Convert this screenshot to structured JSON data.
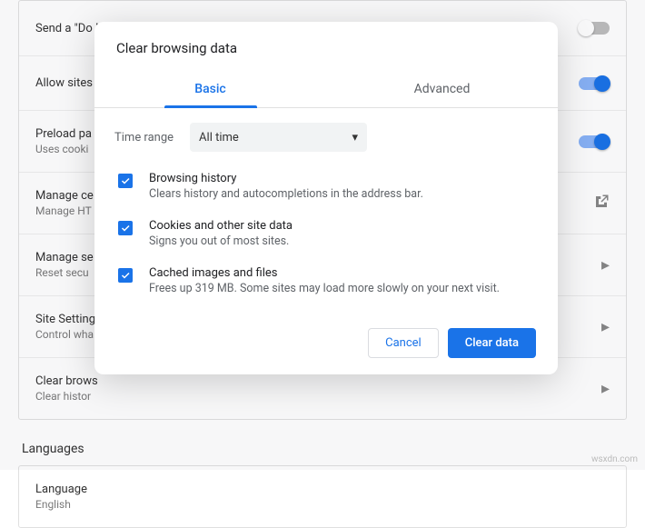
{
  "bg": {
    "rows": [
      {
        "title": "Send a \"Do Not Track\" request with your browsing traffic",
        "sub": "",
        "right": "toggle-off"
      },
      {
        "title": "Allow sites",
        "sub": "",
        "right": "toggle-on"
      },
      {
        "title": "Preload pa",
        "sub": "Uses cooki",
        "right": "toggle-on"
      },
      {
        "title": "Manage ce",
        "sub": "Manage HT",
        "right": "external"
      },
      {
        "title": "Manage se",
        "sub": "Reset secu",
        "right": "chevron"
      },
      {
        "title": "Site Setting",
        "sub": "Control wha",
        "right": "chevron"
      },
      {
        "title": "Clear brows",
        "sub": "Clear histor",
        "right": "chevron"
      }
    ],
    "section_heading": "Languages",
    "lang_row": {
      "title": "Language",
      "sub": "English"
    }
  },
  "dialog": {
    "title": "Clear browsing data",
    "tabs": {
      "basic": "Basic",
      "advanced": "Advanced"
    },
    "range_label": "Time range",
    "range_value": "All time",
    "options": [
      {
        "title": "Browsing history",
        "sub": "Clears history and autocompletions in the address bar."
      },
      {
        "title": "Cookies and other site data",
        "sub": "Signs you out of most sites."
      },
      {
        "title": "Cached images and files",
        "sub": "Frees up 319 MB. Some sites may load more slowly on your next visit."
      }
    ],
    "cancel": "Cancel",
    "confirm": "Clear data"
  },
  "watermark": "wsxdn.com"
}
